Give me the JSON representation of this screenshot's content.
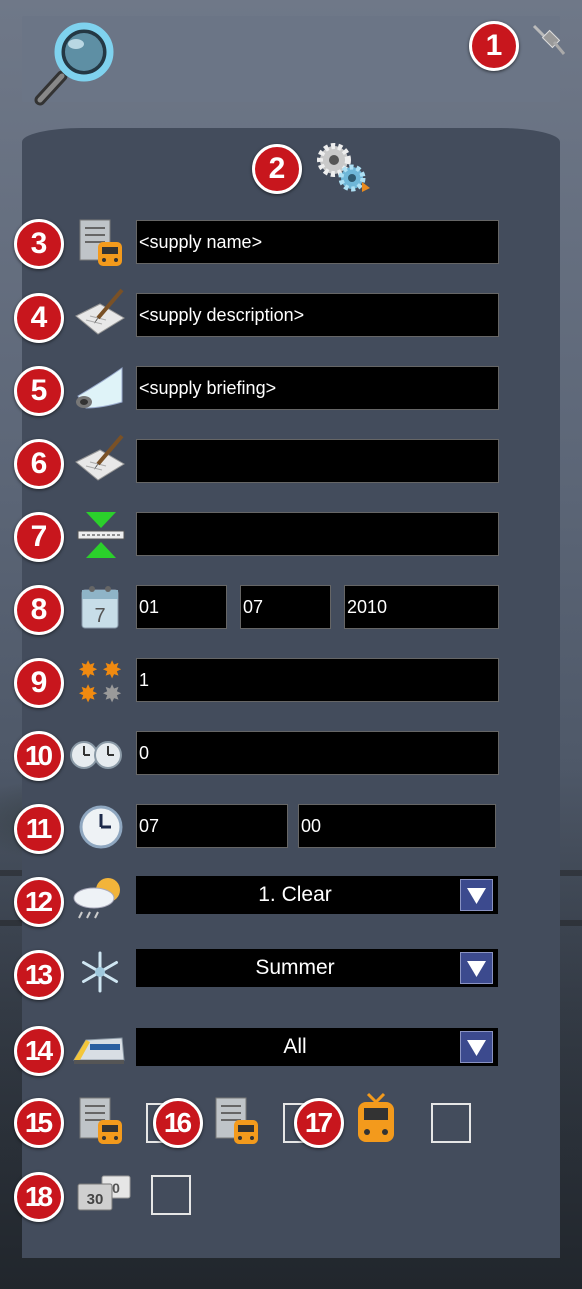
{
  "badges": [
    "1",
    "2",
    "3",
    "4",
    "5",
    "6",
    "7",
    "8",
    "9",
    "10",
    "11",
    "12",
    "13",
    "14",
    "15",
    "16",
    "17",
    "18"
  ],
  "fields": {
    "supply_name": "<supply name>",
    "supply_description": "<supply description>",
    "supply_briefing": "<supply briefing>",
    "field_6": "",
    "field_7": "",
    "date_day": "01",
    "date_month": "07",
    "date_year": "2010",
    "difficulty": "1",
    "duration": "0",
    "time_hour": "07",
    "time_minute": "00"
  },
  "dropdowns": {
    "weather": "1. Clear",
    "season": "Summer",
    "train_filter": "All"
  },
  "checkboxes": {
    "option_15": false,
    "option_16": false,
    "option_17": false,
    "option_18": false
  },
  "icons": {
    "search": "magnifier-icon",
    "pin": "pin-icon",
    "settings": "gears-icon",
    "name": "train-document-icon",
    "description": "pen-paper-icon",
    "briefing": "scroll-icon",
    "notes": "pen-paper-icon",
    "route": "track-gauge-icon",
    "date": "calendar-icon",
    "difficulty": "stars-icon",
    "duration": "clocks-icon",
    "start_time": "clock-icon",
    "weather": "weather-icon",
    "season": "snowflake-icon",
    "train_filter": "train-icon",
    "option_15": "train-document-icon",
    "option_16": "train-document-icon",
    "option_17": "orange-train-icon",
    "option_18": "speed-sign-icon"
  },
  "colors": {
    "badge": "#c8161d",
    "field_bg": "#000000",
    "panel_bg": "#434c5c",
    "dropdown_arrow": "#3c4a8e"
  }
}
